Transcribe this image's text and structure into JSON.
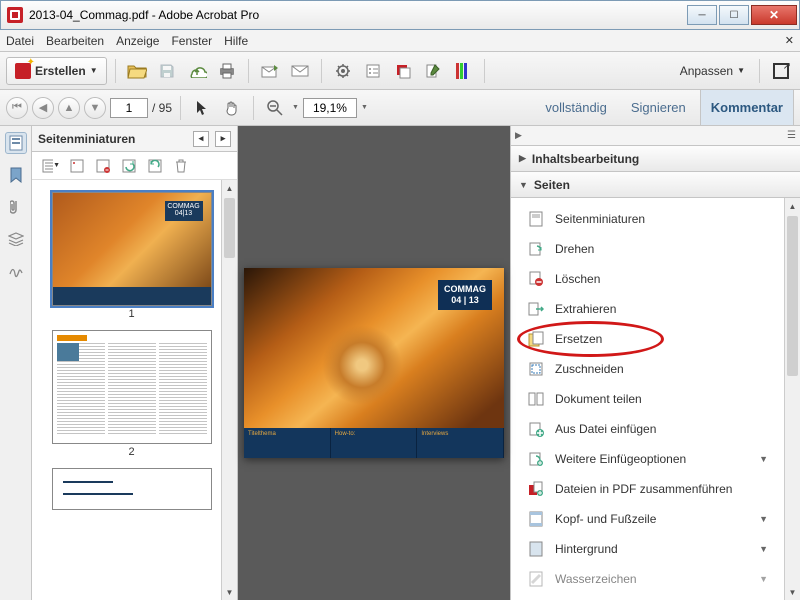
{
  "window": {
    "title": "2013-04_Commag.pdf - Adobe Acrobat Pro"
  },
  "menu": {
    "file": "Datei",
    "edit": "Bearbeiten",
    "view": "Anzeige",
    "window": "Fenster",
    "help": "Hilfe"
  },
  "toolbar": {
    "create": "Erstellen",
    "customize": "Anpassen"
  },
  "nav": {
    "page_current": "1",
    "page_total": "/ 95",
    "zoom": "19,1%"
  },
  "right_links": {
    "complete": "vollständig",
    "sign": "Signieren",
    "comment": "Kommentar"
  },
  "thumbs": {
    "title": "Seitenminiaturen",
    "p1": "1",
    "p2": "2"
  },
  "doc": {
    "badge_l1": "COMMAG",
    "badge_l2": "04 | 13",
    "col1": "Titelthema",
    "col2": "How-to:",
    "col3": "Interviews"
  },
  "right_panel": {
    "section1": "Inhaltsbearbeitung",
    "section2": "Seiten",
    "tools": {
      "thumbs": "Seitenminiaturen",
      "rotate": "Drehen",
      "delete": "Löschen",
      "extract": "Extrahieren",
      "replace": "Ersetzen",
      "crop": "Zuschneiden",
      "split": "Dokument teilen",
      "insert": "Aus Datei einfügen",
      "more_insert": "Weitere Einfügeoptionen",
      "combine": "Dateien in PDF zusammenführen",
      "header_footer": "Kopf- und Fußzeile",
      "background": "Hintergrund",
      "watermark": "Wasserzeichen"
    }
  }
}
